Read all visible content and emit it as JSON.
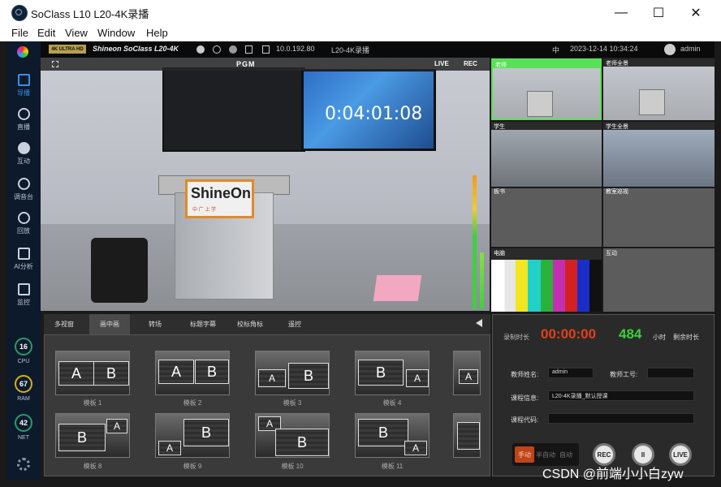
{
  "window": {
    "title": "SoClass L10 L20-4K录播",
    "minimize": "—",
    "maximize": "☐",
    "close": "✕"
  },
  "menu": [
    "File",
    "Edit",
    "View",
    "Window",
    "Help"
  ],
  "sidebar": {
    "items": [
      {
        "label": "导播",
        "icon": "grid-icon"
      },
      {
        "label": "直播",
        "icon": "play-icon"
      },
      {
        "label": "互动",
        "icon": "interact-icon"
      },
      {
        "label": "调音台",
        "icon": "mixer-icon"
      },
      {
        "label": "回放",
        "icon": "replay-icon"
      },
      {
        "label": "AI分析",
        "icon": "ai-icon"
      },
      {
        "label": "监控",
        "icon": "camera-icon"
      }
    ],
    "gauges": [
      {
        "value": "16",
        "label": "CPU",
        "color": "#2a9a6a"
      },
      {
        "value": "67",
        "label": "RAM",
        "color": "#d4b020"
      },
      {
        "value": "42",
        "label": "NET",
        "color": "#2a9a6a"
      }
    ]
  },
  "statusbar": {
    "badge": "4K ULTRA HD",
    "brand": "Shineon SoClass L20-4K",
    "ip": "10.0.192.80",
    "device": "L20-4K录播",
    "lang": "中",
    "datetime": "2023-12-14 10:34:24",
    "user": "admin"
  },
  "pgm": {
    "label": "PGM",
    "live": "LIVE",
    "rec": "REC",
    "timer": "0:04:01:08",
    "logo": "ShineOn",
    "logo_sub": "中  广  上  学"
  },
  "tiles": [
    {
      "label": "老师"
    },
    {
      "label": "老师全景"
    },
    {
      "label": "学生"
    },
    {
      "label": "学生全景"
    },
    {
      "label": "板书"
    },
    {
      "label": "教室巡视"
    },
    {
      "label": "电脑"
    },
    {
      "label": "互动"
    }
  ],
  "tabs": [
    "多视窗",
    "画中画",
    "转场",
    "标题字幕",
    "校标角标",
    "遥控"
  ],
  "templates": [
    {
      "label": "模板 1"
    },
    {
      "label": "模板 2"
    },
    {
      "label": "模板 3"
    },
    {
      "label": "模板 4"
    },
    {
      "label": "模板 8"
    },
    {
      "label": "模板 9"
    },
    {
      "label": "模板 10"
    },
    {
      "label": "模板 11"
    }
  ],
  "template_letters": {
    "a": "A",
    "b": "B"
  },
  "record": {
    "time_label": "录制时长",
    "time": "00:00:00",
    "remaining": "484",
    "hours_unit": "小时",
    "remaining_label": "剩余时长",
    "teacher_name_label": "教师姓名:",
    "teacher_name": "admin",
    "teacher_id_label": "教师工号:",
    "teacher_id": "",
    "course_info_label": "课程信息:",
    "course_info": "L20-4K录播_默认授课",
    "course_code_label": "课程代码:",
    "course_code": "",
    "mode_manual": "手动",
    "mode_semi": "半自动",
    "mode_auto": "自动",
    "btn_rec": "REC",
    "btn_pause": "II",
    "btn_live": "LIVE"
  },
  "watermark": "CSDN @前端小小白zyw"
}
